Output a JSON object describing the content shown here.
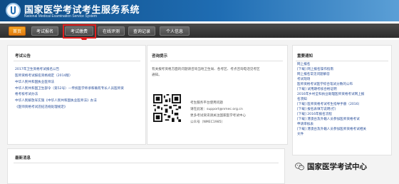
{
  "header": {
    "title": "国家医学考试考生服务系统",
    "subtitle": "National Medical Examination Service System"
  },
  "nav": {
    "items": [
      {
        "label": "首页",
        "active": true
      },
      {
        "label": "考试报名",
        "active": false
      },
      {
        "label": "考试缴费",
        "active": false
      },
      {
        "label": "在线评测",
        "active": false
      },
      {
        "label": "查询记录",
        "active": false
      },
      {
        "label": "个人信息",
        "active": false
      }
    ]
  },
  "announcements": {
    "title": "考试公告",
    "items": [
      "2017年卫生资格考试报名公告",
      "医师资格考试报名资格规定（2014版）",
      "中华人民共和国执业医师法",
      "中华人民共和国卫生部令（第52号）—传统医学师承和确有专长人员医师资",
      "格考核考试办法",
      "中华人民解放军实施《中华人民共和国执业医师法》办法",
      "《医师资格考试违纪违规处理规定》"
    ]
  },
  "tips": {
    "title": "咨询提示",
    "body_lines": [
      "有关报考资格方面的问题请咨询当地卫生局、各考区、考点咨询电话见考区",
      "通知。"
    ],
    "contact_lines": [
      "考生服务平台使用问题",
      "请在此发：support@nmec.org.cn",
      "更多考试资讯请关注国家医学考试中心",
      "公众号（NMEC1985）"
    ]
  },
  "notices": {
    "title": "重要通知",
    "items": [
      "网上报名",
      "[下载] 网上报名操作指南",
      "网上报名常见问题解答",
      "考试现场",
      "医师资格考试医学综合笔试分数的公布",
      "[下载] 试用期考核合格证明",
      "2016年乡村全科执业助理医师资格考试网上报",
      "名须知",
      "[下载] 医师资格考试考生指导手册（2016）",
      "[下载] 报名表填写说明(打)",
      "[下载] 2016年报名流程",
      "[下载] 港澳台及外籍人员参加医师资格考试",
      "申请审核表",
      "[下载] 港澳台及外籍人员参加医师资格考试相关",
      "文件"
    ]
  },
  "latest": {
    "title": "最新消息"
  },
  "watermark": {
    "text": "国家医学考试中心",
    "icon": "wechat-icon"
  },
  "colors": {
    "header_blue": "#1f6db3",
    "nav_active": "#f5a623",
    "highlight_red": "#e02020",
    "link_blue": "#2a4f9a"
  }
}
